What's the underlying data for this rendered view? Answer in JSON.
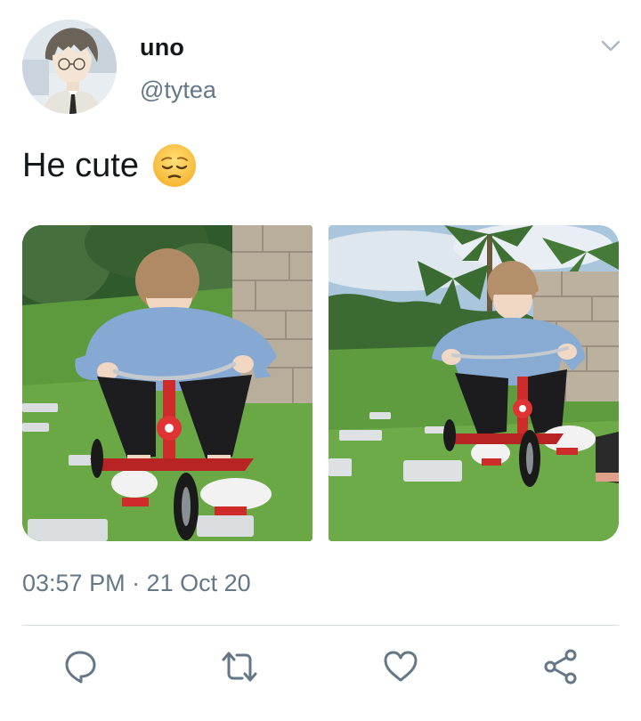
{
  "user": {
    "display_name": "uno",
    "handle": "@tytea"
  },
  "tweet": {
    "text": "He cute",
    "emoji": "pensive-face-emoji",
    "timestamp": "03:57 PM · 21 Oct 20"
  },
  "media": [
    {
      "name": "photo-left"
    },
    {
      "name": "photo-right"
    }
  ],
  "actions": [
    "reply",
    "retweet",
    "like",
    "share"
  ],
  "colors": {
    "text": "#14171a",
    "secondary": "#657786",
    "divider": "#d7dde2",
    "icon": "#657786"
  }
}
